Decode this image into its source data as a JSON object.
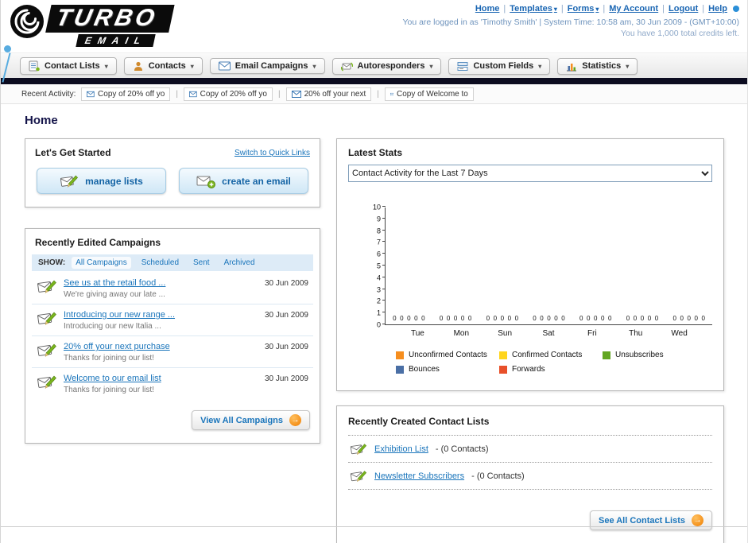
{
  "brand": {
    "title": "TURBO",
    "subtitle": "EMAIL"
  },
  "ui": {
    "chevron_down": "▾",
    "arrow_right": "→",
    "separator": "|"
  },
  "header": {
    "links": [
      {
        "label": "Home",
        "dropdown": false
      },
      {
        "label": "Templates",
        "dropdown": true
      },
      {
        "label": "Forms",
        "dropdown": true
      },
      {
        "label": "My Account",
        "dropdown": false
      },
      {
        "label": "Logout",
        "dropdown": false
      },
      {
        "label": "Help",
        "dropdown": false
      }
    ],
    "session_text": "You are logged in as 'Timothy Smith' | System Time: 10:58 am, 30 Jun 2009 - (GMT+10:00)",
    "credits_text": "You have 1,000 total credits left."
  },
  "nav": {
    "tabs": [
      {
        "label": "Contact Lists"
      },
      {
        "label": "Contacts"
      },
      {
        "label": "Email Campaigns"
      },
      {
        "label": "Autoresponders"
      },
      {
        "label": "Custom Fields"
      },
      {
        "label": "Statistics"
      }
    ]
  },
  "recent_activity": {
    "label": "Recent Activity:",
    "items": [
      "Copy of 20% off yo",
      "Copy of 20% off yo",
      "20% off your next",
      "Copy of Welcome to"
    ]
  },
  "page": {
    "title": "Home"
  },
  "get_started": {
    "title": "Let's Get Started",
    "switch_link": "Switch to Quick Links",
    "manage_lists_label": "manage lists",
    "create_email_label": "create an email"
  },
  "campaigns": {
    "title": "Recently Edited Campaigns",
    "show_label": "SHOW:",
    "filters": [
      "All Campaigns",
      "Scheduled",
      "Sent",
      "Archived"
    ],
    "active_filter": "All Campaigns",
    "rows": [
      {
        "title": "See us at the retail food ...",
        "subtitle": "We're giving away our late ...",
        "date": "30 Jun 2009"
      },
      {
        "title": "Introducing our new range ...",
        "subtitle": "Introducing our new Italia ...",
        "date": "30 Jun 2009"
      },
      {
        "title": "20% off your next purchase",
        "subtitle": "Thanks for joining our list!",
        "date": "30 Jun 2009"
      },
      {
        "title": "Welcome to our email list",
        "subtitle": "Thanks for joining our list!",
        "date": "30 Jun 2009"
      }
    ],
    "view_all_label": "View All Campaigns"
  },
  "stats": {
    "title": "Latest Stats",
    "dropdown_value": "Contact Activity for the Last 7 Days"
  },
  "chart_data": {
    "type": "bar",
    "title": "Contact Activity for the Last 7 Days",
    "categories": [
      "Tue",
      "Mon",
      "Sun",
      "Sat",
      "Fri",
      "Thu",
      "Wed"
    ],
    "series": [
      {
        "name": "Unconfirmed Contacts",
        "color": "#F68E1E",
        "values": [
          0,
          0,
          0,
          0,
          0,
          0,
          0
        ]
      },
      {
        "name": "Confirmed Contacts",
        "color": "#FFD51E",
        "values": [
          0,
          0,
          0,
          0,
          0,
          0,
          0
        ]
      },
      {
        "name": "Unsubscribes",
        "color": "#62A621",
        "values": [
          0,
          0,
          0,
          0,
          0,
          0,
          0
        ]
      },
      {
        "name": "Bounces",
        "color": "#4A6FA5",
        "values": [
          0,
          0,
          0,
          0,
          0,
          0,
          0
        ]
      },
      {
        "name": "Forwards",
        "color": "#E8502A",
        "values": [
          0,
          0,
          0,
          0,
          0,
          0,
          0
        ]
      }
    ],
    "ylim": [
      0,
      10
    ],
    "y_tick_step": 1,
    "grid": false,
    "legend_position": "bottom"
  },
  "contact_lists": {
    "title": "Recently Created Contact Lists",
    "rows": [
      {
        "name": "Exhibition List",
        "detail": "- (0 Contacts)"
      },
      {
        "name": "Newsletter Subscribers",
        "detail": "- (0 Contacts)"
      }
    ],
    "see_all_label": "See All Contact Lists"
  }
}
